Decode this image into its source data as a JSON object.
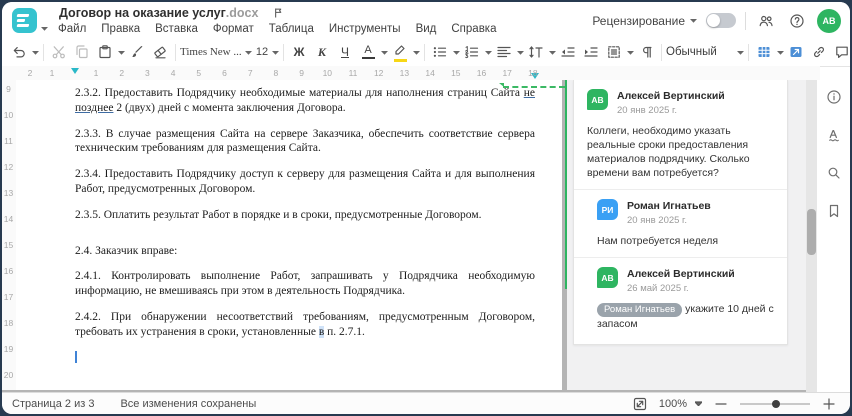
{
  "header": {
    "title": "Договор на оказание услуг",
    "title_ext": ".docx",
    "menu": [
      "Файл",
      "Правка",
      "Вставка",
      "Формат",
      "Таблица",
      "Инструменты",
      "Вид",
      "Справка"
    ],
    "review_label": "Рецензирование",
    "avatar_initials": "АВ"
  },
  "toolbar": {
    "font_name": "Times New ...",
    "font_size": "12",
    "bold": "Ж",
    "italic": "К",
    "underline": "Ч",
    "font_color_letter": "А",
    "style_name": "Обычный"
  },
  "ruler": {
    "h_left": [
      "2",
      "1"
    ],
    "h_main": [
      "1",
      "2",
      "3",
      "4",
      "5",
      "6",
      "7",
      "8",
      "9",
      "10",
      "11",
      "12",
      "13",
      "14",
      "15",
      "16",
      "17",
      "18"
    ],
    "v": [
      "9",
      "10",
      "11",
      "12",
      "13",
      "14",
      "15",
      "16",
      "17",
      "18",
      "19",
      "20"
    ]
  },
  "document": {
    "paragraphs": [
      {
        "runs": [
          {
            "t": "2.3.2. Предоставить Подрядчику необходимые материалы для наполнения страниц Сайта "
          },
          {
            "t": "не позднее",
            "s": "u"
          },
          {
            "t": " 2 (двух) дней с момента заключения Договора."
          }
        ]
      },
      {
        "runs": [
          {
            "t": "2.3.3. В случае размещения Сайта на сервере Заказчика, обеспечить соответствие сервера техническим требованиям для размещения Сайта."
          }
        ]
      },
      {
        "runs": [
          {
            "t": "2.3.4. Предоставить Подрядчику доступ к серверу для размещения Сайта и для выполнения Работ, предусмотренных Договором."
          }
        ]
      },
      {
        "runs": [
          {
            "t": "2.3.5. Оплатить результат Работ в порядке и в сроки, предусмотренные Договором."
          }
        ]
      },
      {
        "runs": [
          {
            "t": "2.4. Заказчик вправе:"
          }
        ]
      },
      {
        "runs": [
          {
            "t": "2.4.1. Контролировать выполнение Работ, запрашивать у Подрядчика необходимую информацию, не вмешиваясь при этом в деятельность Подрядчика."
          }
        ]
      },
      {
        "runs": [
          {
            "t": "2.4.2. При обнаружении несоответствий требованиям, предусмотренным Договором, требовать их устранения в сроки, установленные "
          },
          {
            "t": "в",
            "s": "hl"
          },
          {
            "t": " п. 2.7.1."
          }
        ]
      }
    ]
  },
  "comments": {
    "items": [
      {
        "initials": "АВ",
        "color": "#2eb561",
        "name": "Алексей Вертинский",
        "date": "20 янв 2025 г.",
        "text": "Коллеги, необходимо указать реальные сроки предоставления материалов подрядчику. Сколько времени вам потребуется?",
        "reply": false
      },
      {
        "initials": "РИ",
        "color": "#3aa0f4",
        "name": "Роман Игнатьев",
        "date": "20 янв 2025 г.",
        "text": "Нам потребуется неделя",
        "reply": true
      },
      {
        "initials": "АВ",
        "color": "#2eb561",
        "name": "Алексей Вертинский",
        "date": "26 май 2025 г.",
        "mention": "Роман Игнатьев",
        "text": "укажите 10 дней с запасом",
        "reply": true
      }
    ]
  },
  "status": {
    "page_info": "Страница 2 из 3",
    "saved": "Все изменения сохранены",
    "zoom": "100%"
  },
  "colors": {
    "accent_teal": "#35c3cf",
    "comment_green": "#2eb561",
    "reply_blue": "#3aa0f4",
    "toolbar_blue": "#4d8fd6"
  }
}
